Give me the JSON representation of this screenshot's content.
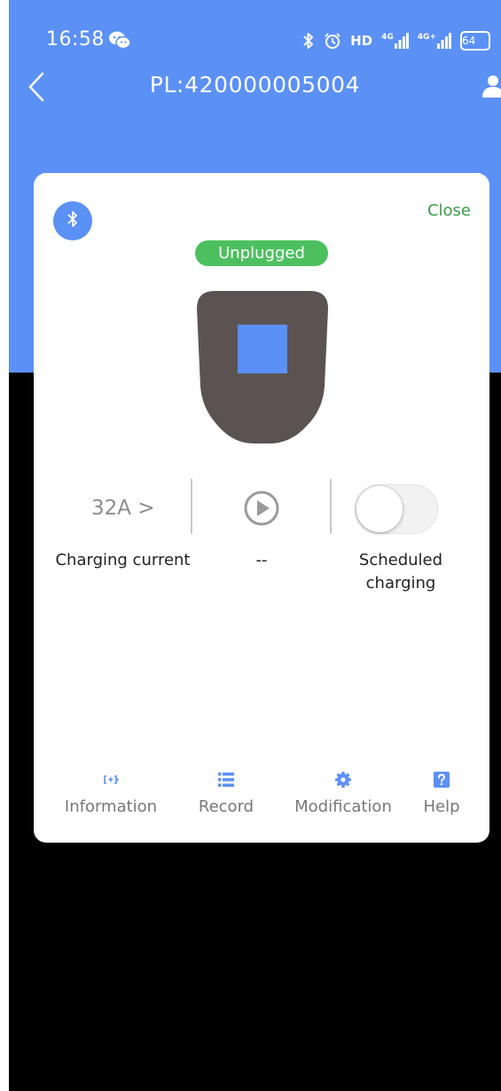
{
  "status_bar": {
    "time": "16:58",
    "hd_label": "HD",
    "signal_1_label": "4G",
    "signal_2_label": "4G+",
    "battery_level": "64"
  },
  "nav": {
    "title": "PL:420000005004"
  },
  "card": {
    "close_label": "Close",
    "status_badge": "Unplugged",
    "current_value": "32A >",
    "current_label": "Charging current",
    "middle_label": "--",
    "scheduled_label_line1": "Scheduled",
    "scheduled_label_line2": "charging",
    "scheduled_enabled": false
  },
  "tabs": [
    {
      "label": "Information",
      "icon": "charger-info-icon"
    },
    {
      "label": "Record",
      "icon": "list-icon"
    },
    {
      "label": "Modification",
      "icon": "gear-icon"
    },
    {
      "label": "Help",
      "icon": "help-icon"
    }
  ],
  "colors": {
    "accent": "#5b90f5",
    "badge": "#4cc05e",
    "close": "#3b9e49",
    "charger_body": "#5b5351"
  }
}
